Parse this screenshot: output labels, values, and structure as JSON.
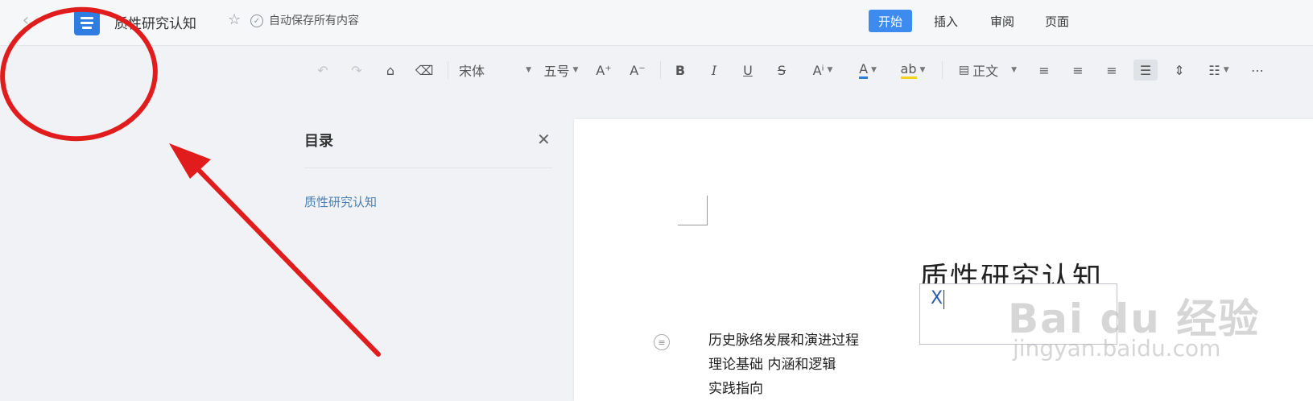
{
  "titlebar": {
    "doc_title": "质性研究认知",
    "autosave": "自动保存所有内容",
    "tabs": [
      {
        "label": "开始",
        "active": true
      },
      {
        "label": "插入",
        "active": false
      },
      {
        "label": "审阅",
        "active": false
      },
      {
        "label": "页面",
        "active": false
      }
    ]
  },
  "toolbar": {
    "font_name": "宋体",
    "font_size": "五号",
    "paragraph_style": "正文",
    "grow_font": "A⁺",
    "shrink_font": "A⁻",
    "bold": "B",
    "italic": "I",
    "underline": "U",
    "strike": "S",
    "font_color": "A",
    "highlight": "ab"
  },
  "toc": {
    "title": "目录",
    "items": [
      "质性研究认知"
    ]
  },
  "document": {
    "heading": "质性研究认知",
    "ime_input": "X",
    "outline": [
      "历史脉络发展和演进过程",
      "理论基础  内涵和逻辑",
      "实践指向"
    ]
  },
  "watermark": {
    "main": "Bai du 经验",
    "sub": "jingyan.baidu.com"
  },
  "colors": {
    "accent": "#3d8bef",
    "annotation": "#e01c1c"
  }
}
